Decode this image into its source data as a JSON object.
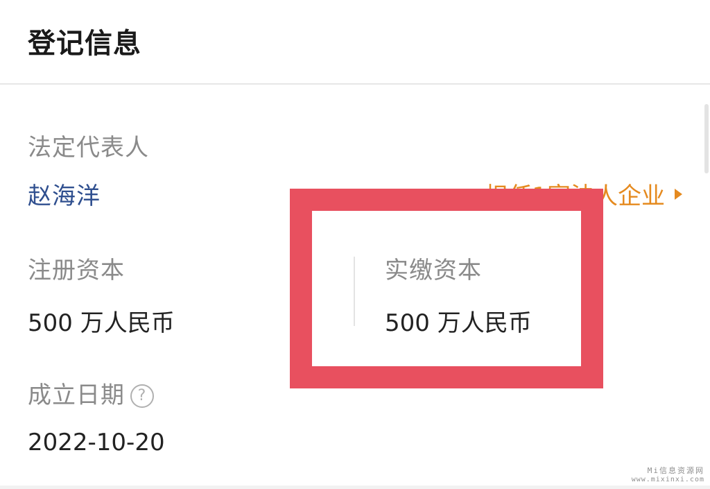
{
  "section": {
    "title": "登记信息"
  },
  "legal_representative": {
    "label": "法定代表人",
    "name": "赵海洋",
    "serving_link": "担任1家法人企业"
  },
  "registered_capital": {
    "label": "注册资本",
    "value": "500 万人民币"
  },
  "paid_in_capital": {
    "label": "实缴资本",
    "value": "500 万人民币"
  },
  "established_date": {
    "label": "成立日期",
    "help_icon": "question-circle-icon",
    "value": "2022-10-20"
  },
  "annotation": {
    "highlight_color": "#e8505f"
  },
  "colors": {
    "label": "#8a8a8a",
    "value": "#222222",
    "link_blue": "#2f4f8f",
    "link_orange": "#e58a1f"
  },
  "watermark": {
    "title": "Mi信息资源网",
    "url": "www.mixinxi.com"
  }
}
